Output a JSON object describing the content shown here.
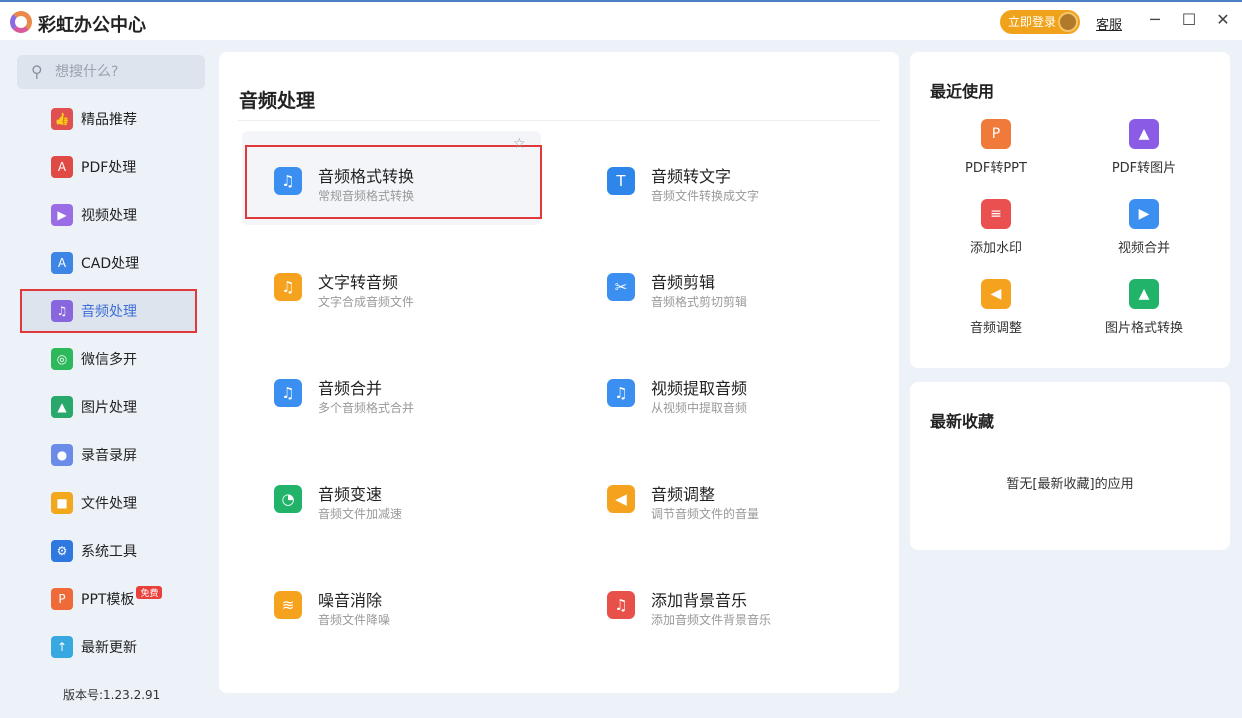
{
  "app": {
    "title": "彩虹办公中心",
    "login": "立即登录",
    "support": "客服"
  },
  "search": {
    "placeholder": "想搜什么?"
  },
  "sidebar": {
    "items": [
      {
        "label": "精品推荐",
        "icon": "thumbs-up-icon",
        "color": "#e05050",
        "glyph": "👍"
      },
      {
        "label": "PDF处理",
        "icon": "pdf-icon",
        "color": "#e04a44",
        "glyph": "A"
      },
      {
        "label": "视频处理",
        "icon": "video-icon",
        "color": "#9a6ce6",
        "glyph": "▶"
      },
      {
        "label": "CAD处理",
        "icon": "cad-icon",
        "color": "#3d86e6",
        "glyph": "A"
      },
      {
        "label": "音频处理",
        "icon": "music-icon",
        "color": "#8866dd",
        "glyph": "♫"
      },
      {
        "label": "微信多开",
        "icon": "wechat-icon",
        "color": "#2eb85c",
        "glyph": "◎"
      },
      {
        "label": "图片处理",
        "icon": "image-icon",
        "color": "#28a86a",
        "glyph": "▲"
      },
      {
        "label": "录音录屏",
        "icon": "microphone-icon",
        "color": "#6a8ce8",
        "glyph": "●"
      },
      {
        "label": "文件处理",
        "icon": "folder-icon",
        "color": "#f2a81c",
        "glyph": "■"
      },
      {
        "label": "系统工具",
        "icon": "gear-icon",
        "color": "#2f78e0",
        "glyph": "⚙"
      },
      {
        "label": "PPT模板",
        "icon": "ppt-icon",
        "color": "#ee6a38",
        "glyph": "P",
        "badge": "免费"
      },
      {
        "label": "最新更新",
        "icon": "upload-icon",
        "color": "#38a8e0",
        "glyph": "↑"
      }
    ],
    "version": "版本号:1.23.2.91"
  },
  "main": {
    "title": "音频处理",
    "tools": [
      {
        "name": "音频格式转换",
        "desc": "常规音频格式转换",
        "icon": "audio-convert-icon",
        "color": "#3b8ff0",
        "glyph": "♫"
      },
      {
        "name": "音频转文字",
        "desc": "音频文件转换成文字",
        "icon": "audio-to-text-icon",
        "color": "#2f86ea",
        "glyph": "T"
      },
      {
        "name": "文字转音频",
        "desc": "文字合成音频文件",
        "icon": "text-to-audio-icon",
        "color": "#f5a31e",
        "glyph": "♫"
      },
      {
        "name": "音频剪辑",
        "desc": "音频格式剪切剪辑",
        "icon": "audio-cut-icon",
        "color": "#3b8ff0",
        "glyph": "✂"
      },
      {
        "name": "音频合并",
        "desc": "多个音频格式合并",
        "icon": "audio-merge-icon",
        "color": "#3b8ff0",
        "glyph": "♫"
      },
      {
        "name": "视频提取音频",
        "desc": "从视频中提取音频",
        "icon": "extract-audio-icon",
        "color": "#3b8ff0",
        "glyph": "♫"
      },
      {
        "name": "音频变速",
        "desc": "音频文件加减速",
        "icon": "audio-speed-icon",
        "color": "#22b36a",
        "glyph": "◔"
      },
      {
        "name": "音频调整",
        "desc": "调节音频文件的音量",
        "icon": "volume-icon",
        "color": "#f5a31e",
        "glyph": "◀"
      },
      {
        "name": "噪音消除",
        "desc": "音频文件降噪",
        "icon": "noise-reduce-icon",
        "color": "#f5a31e",
        "glyph": "≋"
      },
      {
        "name": "添加背景音乐",
        "desc": "添加音频文件背景音乐",
        "icon": "bg-music-icon",
        "color": "#e8504a",
        "glyph": "♫"
      }
    ]
  },
  "recent": {
    "title": "最近使用",
    "items": [
      {
        "label": "PDF转PPT",
        "icon": "pdf-to-ppt-icon",
        "color": "#f07a3a",
        "glyph": "P"
      },
      {
        "label": "PDF转图片",
        "icon": "pdf-to-image-icon",
        "color": "#8a5ce6",
        "glyph": "▲"
      },
      {
        "label": "添加水印",
        "icon": "watermark-icon",
        "color": "#ea5050",
        "glyph": "≡"
      },
      {
        "label": "视频合并",
        "icon": "video-merge-icon",
        "color": "#3b8ff0",
        "glyph": "▶"
      },
      {
        "label": "音频调整",
        "icon": "volume-icon",
        "color": "#f5a31e",
        "glyph": "◀"
      },
      {
        "label": "图片格式转换",
        "icon": "image-convert-icon",
        "color": "#22b36a",
        "glyph": "▲"
      }
    ]
  },
  "favorites": {
    "title": "最新收藏",
    "empty": "暂无[最新收藏]的应用"
  }
}
